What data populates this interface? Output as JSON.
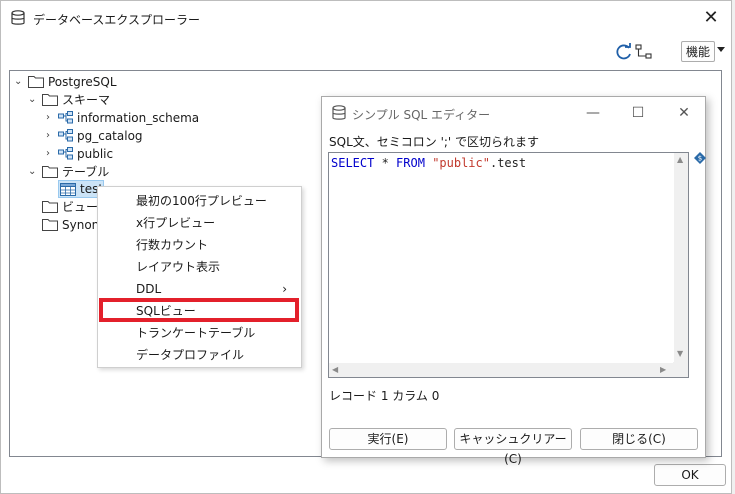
{
  "main_window": {
    "title": "データベースエクスプローラー",
    "close_glyph": "✕",
    "toolbar": {
      "refresh_icon": "refresh-icon",
      "tree_icon": "tree-structure-icon",
      "function_label": "機能"
    },
    "ok_label": "OK"
  },
  "tree": {
    "root": "PostgreSQL",
    "schema_folder": "スキーマ",
    "schemas": [
      "information_schema",
      "pg_catalog",
      "public"
    ],
    "table_folder": "テーブル",
    "table": "test",
    "view_folder": "ビュー",
    "synonym_folder": "Synony"
  },
  "context_menu": {
    "items": [
      "最初の100行プレビュー",
      "x行プレビュー",
      "行数カウント",
      "レイアウト表示",
      "DDL",
      "SQLビュー",
      "トランケートテーブル",
      "データプロファイル"
    ],
    "submenu_arrow": "›",
    "highlight_color": "#e3202b"
  },
  "sql_editor": {
    "title": "シンプル SQL エディター",
    "minimize_glyph": "—",
    "maximize_glyph": "☐",
    "close_glyph": "✕",
    "description": "SQL文、セミコロン ';' で区切られます",
    "code": {
      "kw1": "SELECT",
      "op": " * ",
      "kw2": "FROM",
      "sp": " ",
      "schema": "\"public\"",
      "rest": ".test"
    },
    "status": "レコード 1 カラム 0",
    "buttons": {
      "execute": "実行(E)",
      "clear": "キャッシュクリアー(C)",
      "close": "閉じる(C)"
    }
  }
}
